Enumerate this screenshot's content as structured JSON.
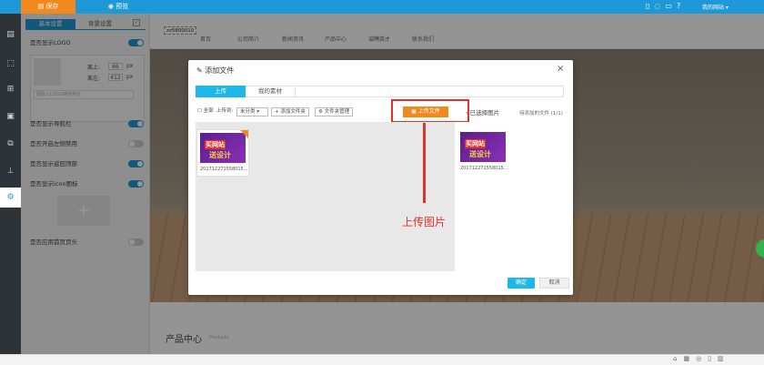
{
  "toolbar": {
    "save_label": "保存",
    "preview_label": "预览",
    "user_label": "我的网站 ▾",
    "icons": [
      "mobile-icon",
      "chat-icon",
      "message-icon",
      "help-icon"
    ]
  },
  "rail": {
    "icons": [
      "page-icon",
      "select-icon",
      "layout-icon",
      "window-icon",
      "copy-icon",
      "sitemap-icon",
      "gear-icon"
    ]
  },
  "panel": {
    "tabs": [
      "基本设置",
      "背景设置"
    ],
    "show_logo": "是否显示LOGO",
    "top_label": "离上:",
    "top_value": "66",
    "left_label": "离左:",
    "left_value": "412",
    "unit": "px",
    "logo_hint": "图标入LOGO链接地址",
    "show_nav": "是否显示导航栏",
    "fixed_nav": "是否开启左侧禁用",
    "show_back_top": "是否显示返回顶部",
    "show_icon": "是否显示icon图标",
    "apply_all": "是否应用首页页头"
  },
  "site": {
    "logo_text": "zz5800010",
    "nav": [
      "首页",
      "公司简介",
      "新闻资讯",
      "产品中心",
      "诚聘英才",
      "联系我们"
    ],
    "section_title": "产品中心",
    "section_sub": "Products"
  },
  "modal": {
    "title": "添加文件",
    "close": "×",
    "tabs": [
      "上传",
      "我的素材"
    ],
    "all_label": "全部",
    "upload_to": "上传到:",
    "category": "未分类",
    "add_folder": "+ 添加文件夹",
    "folder_manage": "⚙ 文件夹管理",
    "upload_button": "上传文件",
    "selected_label": "已选择图片",
    "pending_label": "待添加的文件 (1/1)",
    "thumb_text1": "买网站",
    "thumb_text2": "送设计",
    "file_name": "2017122715580​15...",
    "annotation": "上传图片",
    "ok": "确定",
    "cancel": "取消"
  },
  "colors": {
    "accent": "#1f98d8",
    "orange": "#f08a1c",
    "red": "#e8302a"
  }
}
